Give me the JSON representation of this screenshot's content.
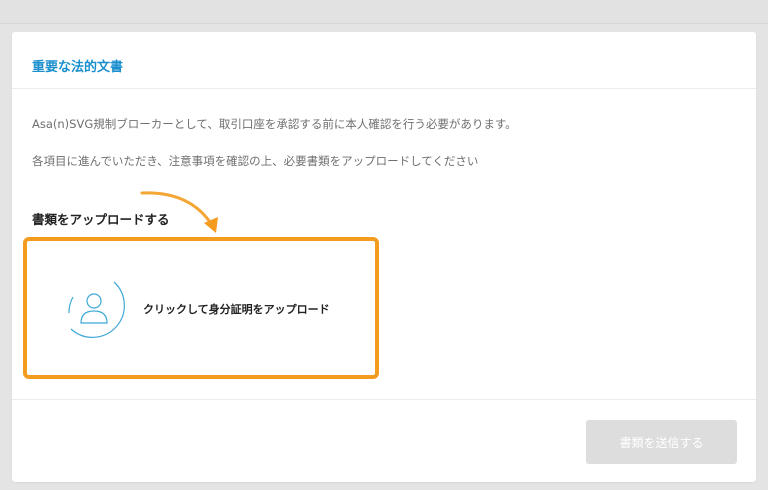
{
  "card": {
    "title": "重要な法的文書",
    "paragraphs": [
      "Asa(n)SVG規制ブローカーとして、取引口座を承認する前に本人確認を行う必要があります。",
      "各項目に進んでいただき、注意事項を確認の上、必要書類をアップロードしてください"
    ],
    "upload_heading": "書類をアップロードする",
    "upload_box": {
      "label": "クリックして身分証明をアップロード",
      "icon": "user-avatar-icon"
    },
    "submit_label": "書類を送信する"
  },
  "colors": {
    "title": "#1b8fce",
    "highlight": "#f39c1f",
    "avatar_stroke": "#3fa9d8",
    "submit_disabled": "#dddddd"
  }
}
